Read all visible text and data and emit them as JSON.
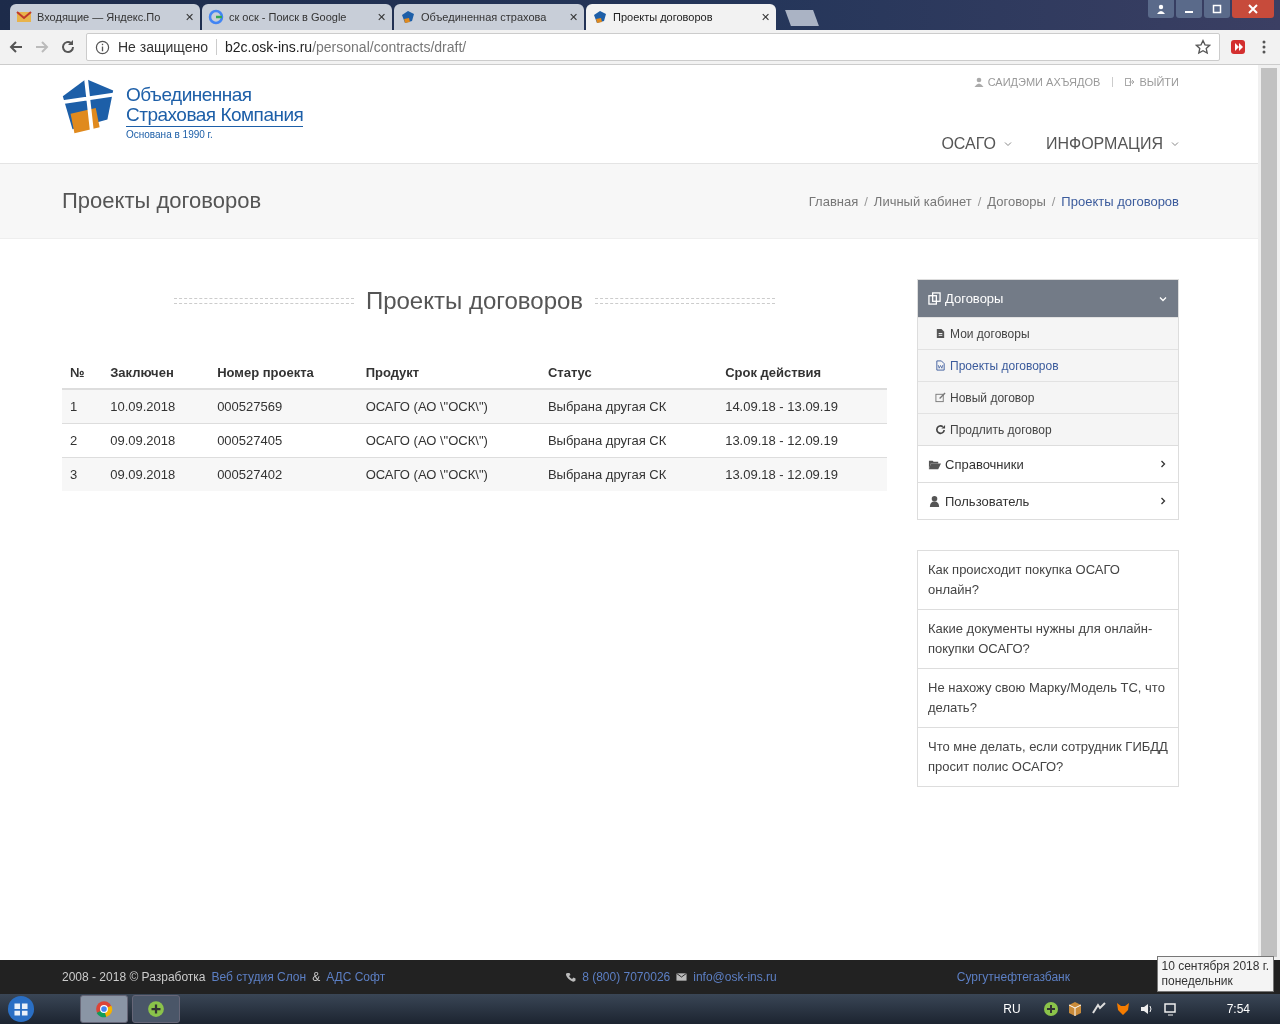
{
  "browser": {
    "tabs": [
      {
        "title": "Входящие — Яндекс.По",
        "kind": "mail",
        "close": "✕",
        "selected": false
      },
      {
        "title": "ск оск - Поиск в Google",
        "kind": "search",
        "close": "✕",
        "selected": false
      },
      {
        "title": "Объединенная страхова",
        "kind": "site",
        "close": "✕",
        "selected": false
      },
      {
        "title": "Проекты договоров",
        "kind": "site",
        "close": "✕",
        "selected": true
      }
    ],
    "security": "Не защищено",
    "url_host": "b2c.osk-ins.ru",
    "url_path": "/personal/contracts/draft/"
  },
  "header": {
    "logo_line1": "Объединенная",
    "logo_line2": "Страховая Компания",
    "logo_tagline": "Основана в 1990 г.",
    "user": "САИДЭМИ АХЪЯДОВ",
    "logout": "ВЫЙТИ",
    "nav": [
      "ОСАГО",
      "ИНФОРМАЦИЯ"
    ]
  },
  "page_title": "Проекты договоров",
  "breadcrumbs": [
    {
      "label": "Главная",
      "selected": false
    },
    {
      "sep": "/",
      "label": "Личный кабинет",
      "selected": false
    },
    {
      "sep": "/",
      "label": "Договоры",
      "selected": false
    },
    {
      "sep": "/",
      "label": "Проекты договоров",
      "selected": true
    }
  ],
  "section_title": "Проекты договоров",
  "table": {
    "columns": [
      "№",
      "Заключен",
      "Номер проекта",
      "Продукт",
      "Статус",
      "Срок действия"
    ],
    "rows": [
      [
        "1",
        "10.09.2018",
        "000527569",
        "ОСАГО (АО \\\"ОСК\\\")",
        "Выбрана другая СК",
        "14.09.18 - 13.09.19"
      ],
      [
        "2",
        "09.09.2018",
        "000527405",
        "ОСАГО (АО \\\"ОСК\\\")",
        "Выбрана другая СК",
        "13.09.18 - 12.09.19"
      ],
      [
        "3",
        "09.09.2018",
        "000527402",
        "ОСАГО (АО \\\"ОСК\\\")",
        "Выбрана другая СК",
        "13.09.18 - 12.09.19"
      ]
    ]
  },
  "sidebar": {
    "groups": [
      {
        "label": "Договоры",
        "kind": "copy",
        "expanded": true,
        "children": [
          {
            "label": "Мои договоры",
            "kind": "file",
            "selected": false
          },
          {
            "label": "Проекты договоров",
            "kind": "word",
            "selected": true
          },
          {
            "label": "Новый договор",
            "kind": "edit",
            "selected": false
          },
          {
            "label": "Продлить договор",
            "kind": "refresh",
            "selected": false
          }
        ]
      },
      {
        "label": "Справочники",
        "kind": "folder",
        "expanded": false
      },
      {
        "label": "Пользователь",
        "kind": "user",
        "expanded": false
      }
    ]
  },
  "faq": [
    "Как происходит покупка ОСАГО онлайн?",
    "Какие документы нужны для онлайн-покупки ОСАГО?",
    "Не нахожу свою Марку/Модель ТС, что делать?",
    "Что мне делать, если сотрудник ГИБДД просит полис ОСАГО?"
  ],
  "footer": {
    "copyright": "2008 - 2018 © Разработка",
    "dev1": "Веб студия Слон",
    "amp": "&",
    "dev2": "АДС Софт",
    "phone": "8 (800) 7070026",
    "email": "info@osk-ins.ru",
    "partner": "Сургутнефтегазбанк"
  },
  "taskbar": {
    "lang": "RU",
    "time": "7:54",
    "tooltip_date": "10 сентября 2018 г.",
    "tooltip_day": "понедельник"
  }
}
